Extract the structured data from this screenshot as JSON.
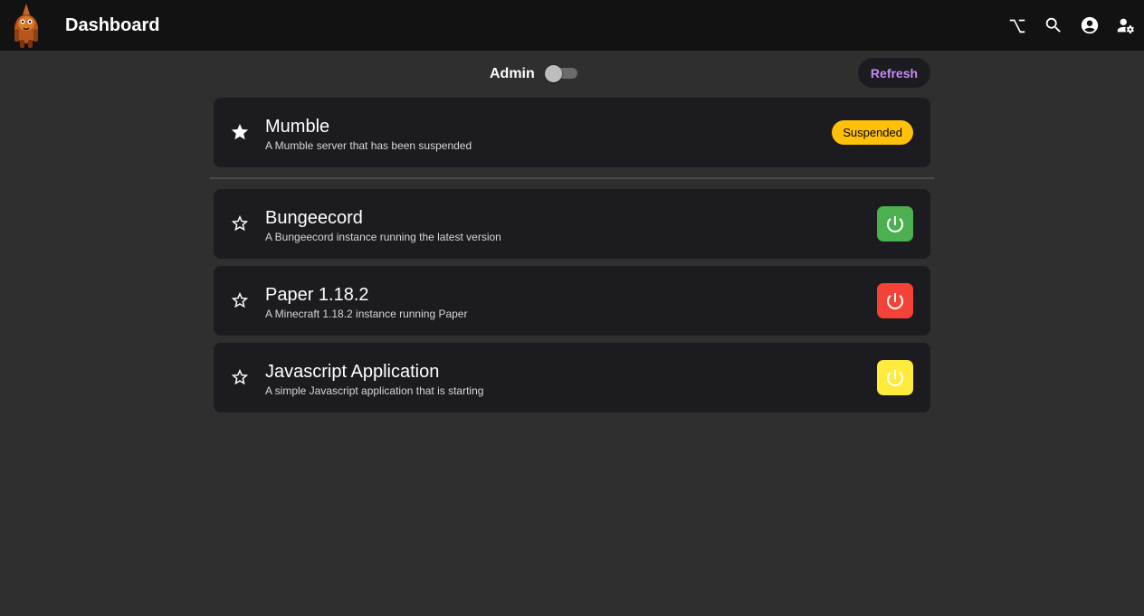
{
  "header": {
    "title": "Dashboard",
    "icons": [
      "option-key-icon",
      "search-icon",
      "account-icon",
      "user-settings-icon"
    ]
  },
  "toolbar": {
    "admin_label": "Admin",
    "admin_enabled": false,
    "refresh_label": "Refresh"
  },
  "colors": {
    "accent": "#c48bf4",
    "suspended": "#ffc107",
    "running": "#4caf50",
    "stopped": "#f44336",
    "starting": "#ffeb3b"
  },
  "favorites": [
    {
      "name": "Mumble",
      "description": "A Mumble server that has been suspended",
      "status": "Suspended",
      "favorited": true
    }
  ],
  "servers": [
    {
      "name": "Bungeecord",
      "description": "A Bungeecord instance running the latest version",
      "state": "running",
      "favorited": false
    },
    {
      "name": "Paper 1.18.2",
      "description": "A Minecraft 1.18.2 instance running Paper",
      "state": "stopped",
      "favorited": false
    },
    {
      "name": "Javascript Application",
      "description": "A simple Javascript application that is starting",
      "state": "starting",
      "favorited": false
    }
  ]
}
